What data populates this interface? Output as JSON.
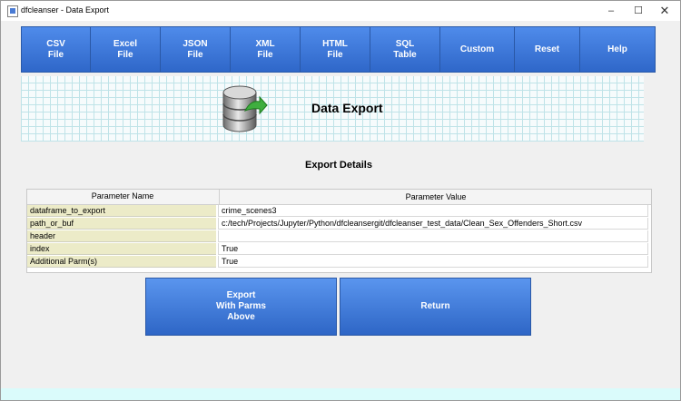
{
  "window": {
    "title": "dfcleanser - Data Export",
    "controls": {
      "minimize": "–",
      "maximize": "☐",
      "close": "✕"
    }
  },
  "toolbar": {
    "buttons": [
      {
        "line1": "CSV",
        "line2": "File"
      },
      {
        "line1": "Excel",
        "line2": "File"
      },
      {
        "line1": "JSON",
        "line2": "File"
      },
      {
        "line1": "XML",
        "line2": "File"
      },
      {
        "line1": "HTML",
        "line2": "File"
      },
      {
        "line1": "SQL",
        "line2": "Table"
      },
      {
        "line1": "Custom",
        "line2": ""
      },
      {
        "line1": "Reset",
        "line2": ""
      },
      {
        "line1": "Help",
        "line2": ""
      }
    ]
  },
  "banner": {
    "title": "Data Export",
    "icon": "database-export-icon"
  },
  "details": {
    "title": "Export Details",
    "columns": {
      "name": "Parameter Name",
      "value": "Parameter Value"
    },
    "rows": [
      {
        "name": "dataframe_to_export",
        "value": "crime_scenes3"
      },
      {
        "name": "path_or_buf",
        "value": "c:/tech/Projects/Jupyter/Python/dfcleansergit/dfcleanser_test_data/Clean_Sex_Offenders_Short.csv"
      },
      {
        "name": "header",
        "value": ""
      },
      {
        "name": "index",
        "value": "True"
      },
      {
        "name": "Additional Parm(s)",
        "value": "True"
      }
    ]
  },
  "actions": {
    "export": {
      "line1": "Export",
      "line2": "With Parms",
      "line3": "Above"
    },
    "return": {
      "label": "Return"
    }
  },
  "colors": {
    "button_blue": "#3d78d8",
    "param_name_bg": "#ecebc8",
    "banner_grid": "#bfe3e8",
    "footer_strip": "#dafbfb"
  }
}
